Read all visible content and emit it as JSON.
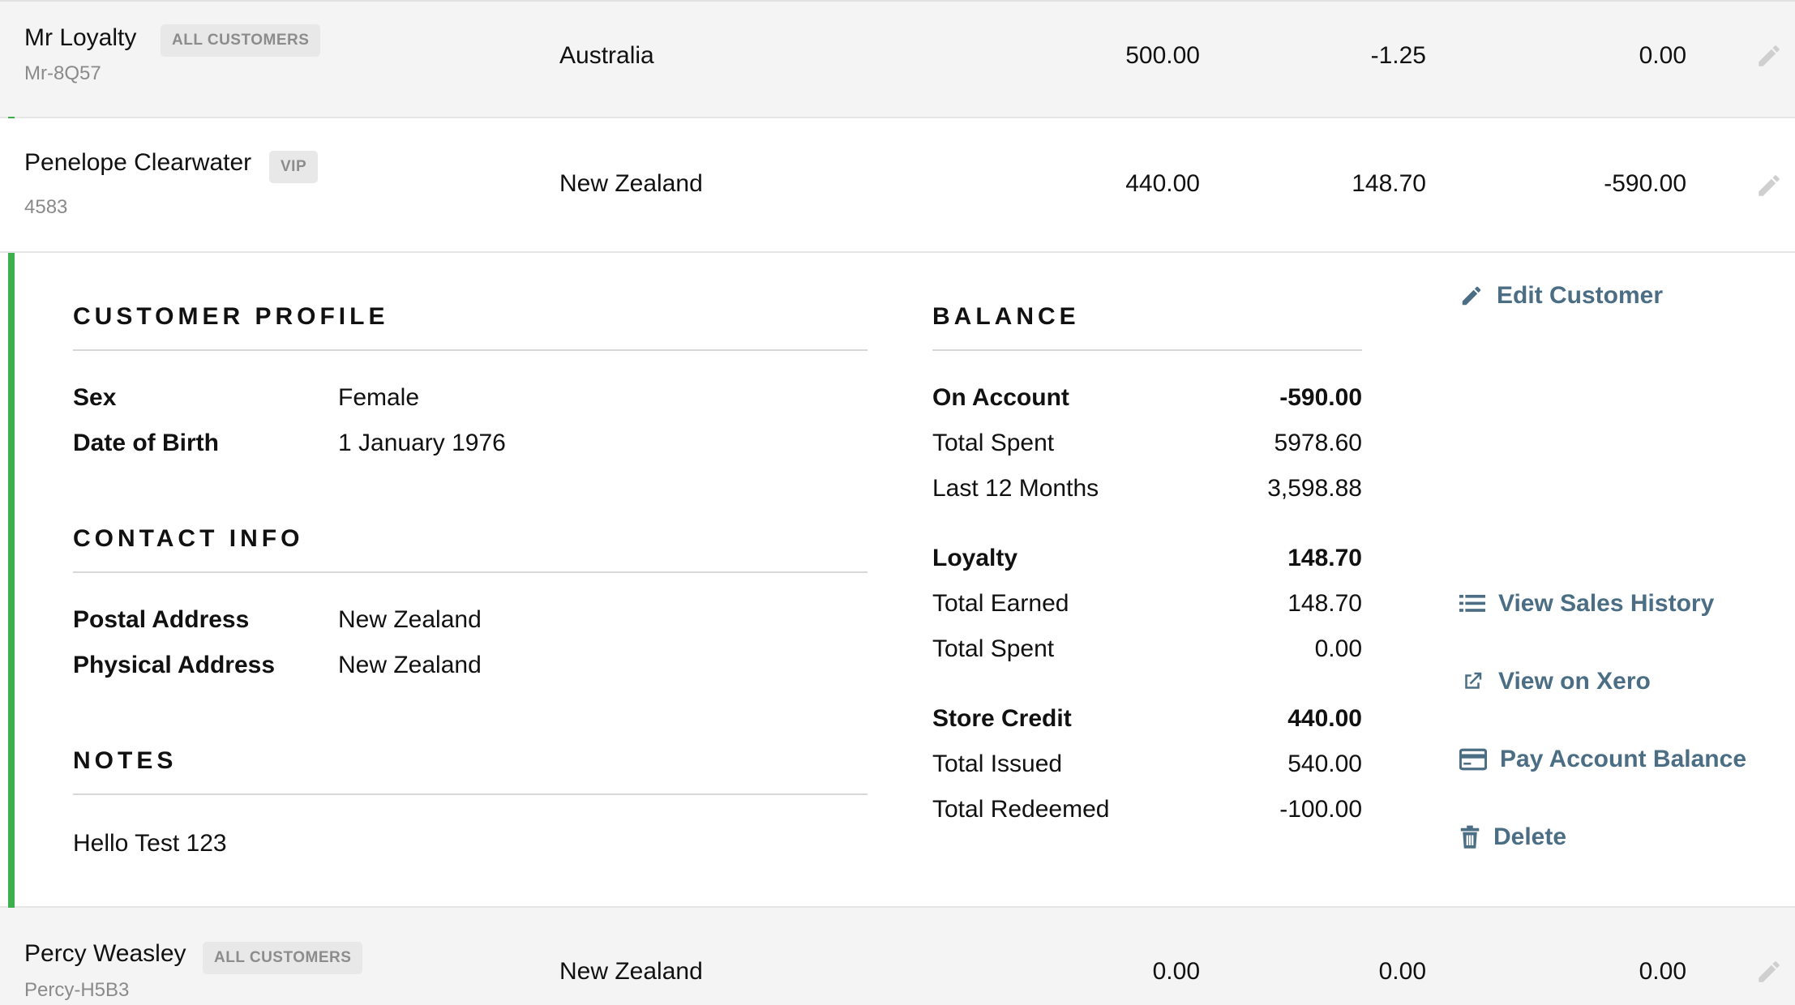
{
  "customers": [
    {
      "name": "Mr Loyalty",
      "group": "ALL CUSTOMERS",
      "code": "Mr-8Q57",
      "country": "Australia",
      "store_credit": "500.00",
      "loyalty": "-1.25",
      "on_account": "0.00"
    },
    {
      "name": "Penelope Clearwater",
      "group": "VIP",
      "code": "4583",
      "country": "New Zealand",
      "store_credit": "440.00",
      "loyalty": "148.70",
      "on_account": "-590.00"
    },
    {
      "name": "Percy Weasley",
      "group": "ALL CUSTOMERS",
      "code": "Percy-H5B3",
      "country": "New Zealand",
      "store_credit": "0.00",
      "loyalty": "0.00",
      "on_account": "0.00"
    }
  ],
  "profile": {
    "title": "CUSTOMER PROFILE",
    "sex_label": "Sex",
    "sex": "Female",
    "dob_label": "Date of Birth",
    "dob": "1 January 1976"
  },
  "contact": {
    "title": "CONTACT INFO",
    "postal_label": "Postal Address",
    "postal": "New Zealand",
    "physical_label": "Physical Address",
    "physical": "New Zealand"
  },
  "notes": {
    "title": "NOTES",
    "text": "Hello Test 123"
  },
  "balance": {
    "title": "BALANCE",
    "on_account_label": "On Account",
    "on_account": "-590.00",
    "total_spent_label": "Total Spent",
    "total_spent": "5978.60",
    "last12_label": "Last 12 Months",
    "last12": "3,598.88",
    "loyalty_label": "Loyalty",
    "loyalty": "148.70",
    "earned_label": "Total Earned",
    "earned": "148.70",
    "loyalty_spent_label": "Total Spent",
    "loyalty_spent": "0.00",
    "store_credit_label": "Store Credit",
    "store_credit": "440.00",
    "issued_label": "Total Issued",
    "issued": "540.00",
    "redeemed_label": "Total Redeemed",
    "redeemed": "-100.00"
  },
  "actions": {
    "edit": "Edit Customer",
    "sales_history": "View Sales History",
    "xero": "View on Xero",
    "pay": "Pay Account Balance",
    "delete": "Delete"
  },
  "colors": {
    "accent": "#3cb04a",
    "link": "#4b6e85"
  }
}
